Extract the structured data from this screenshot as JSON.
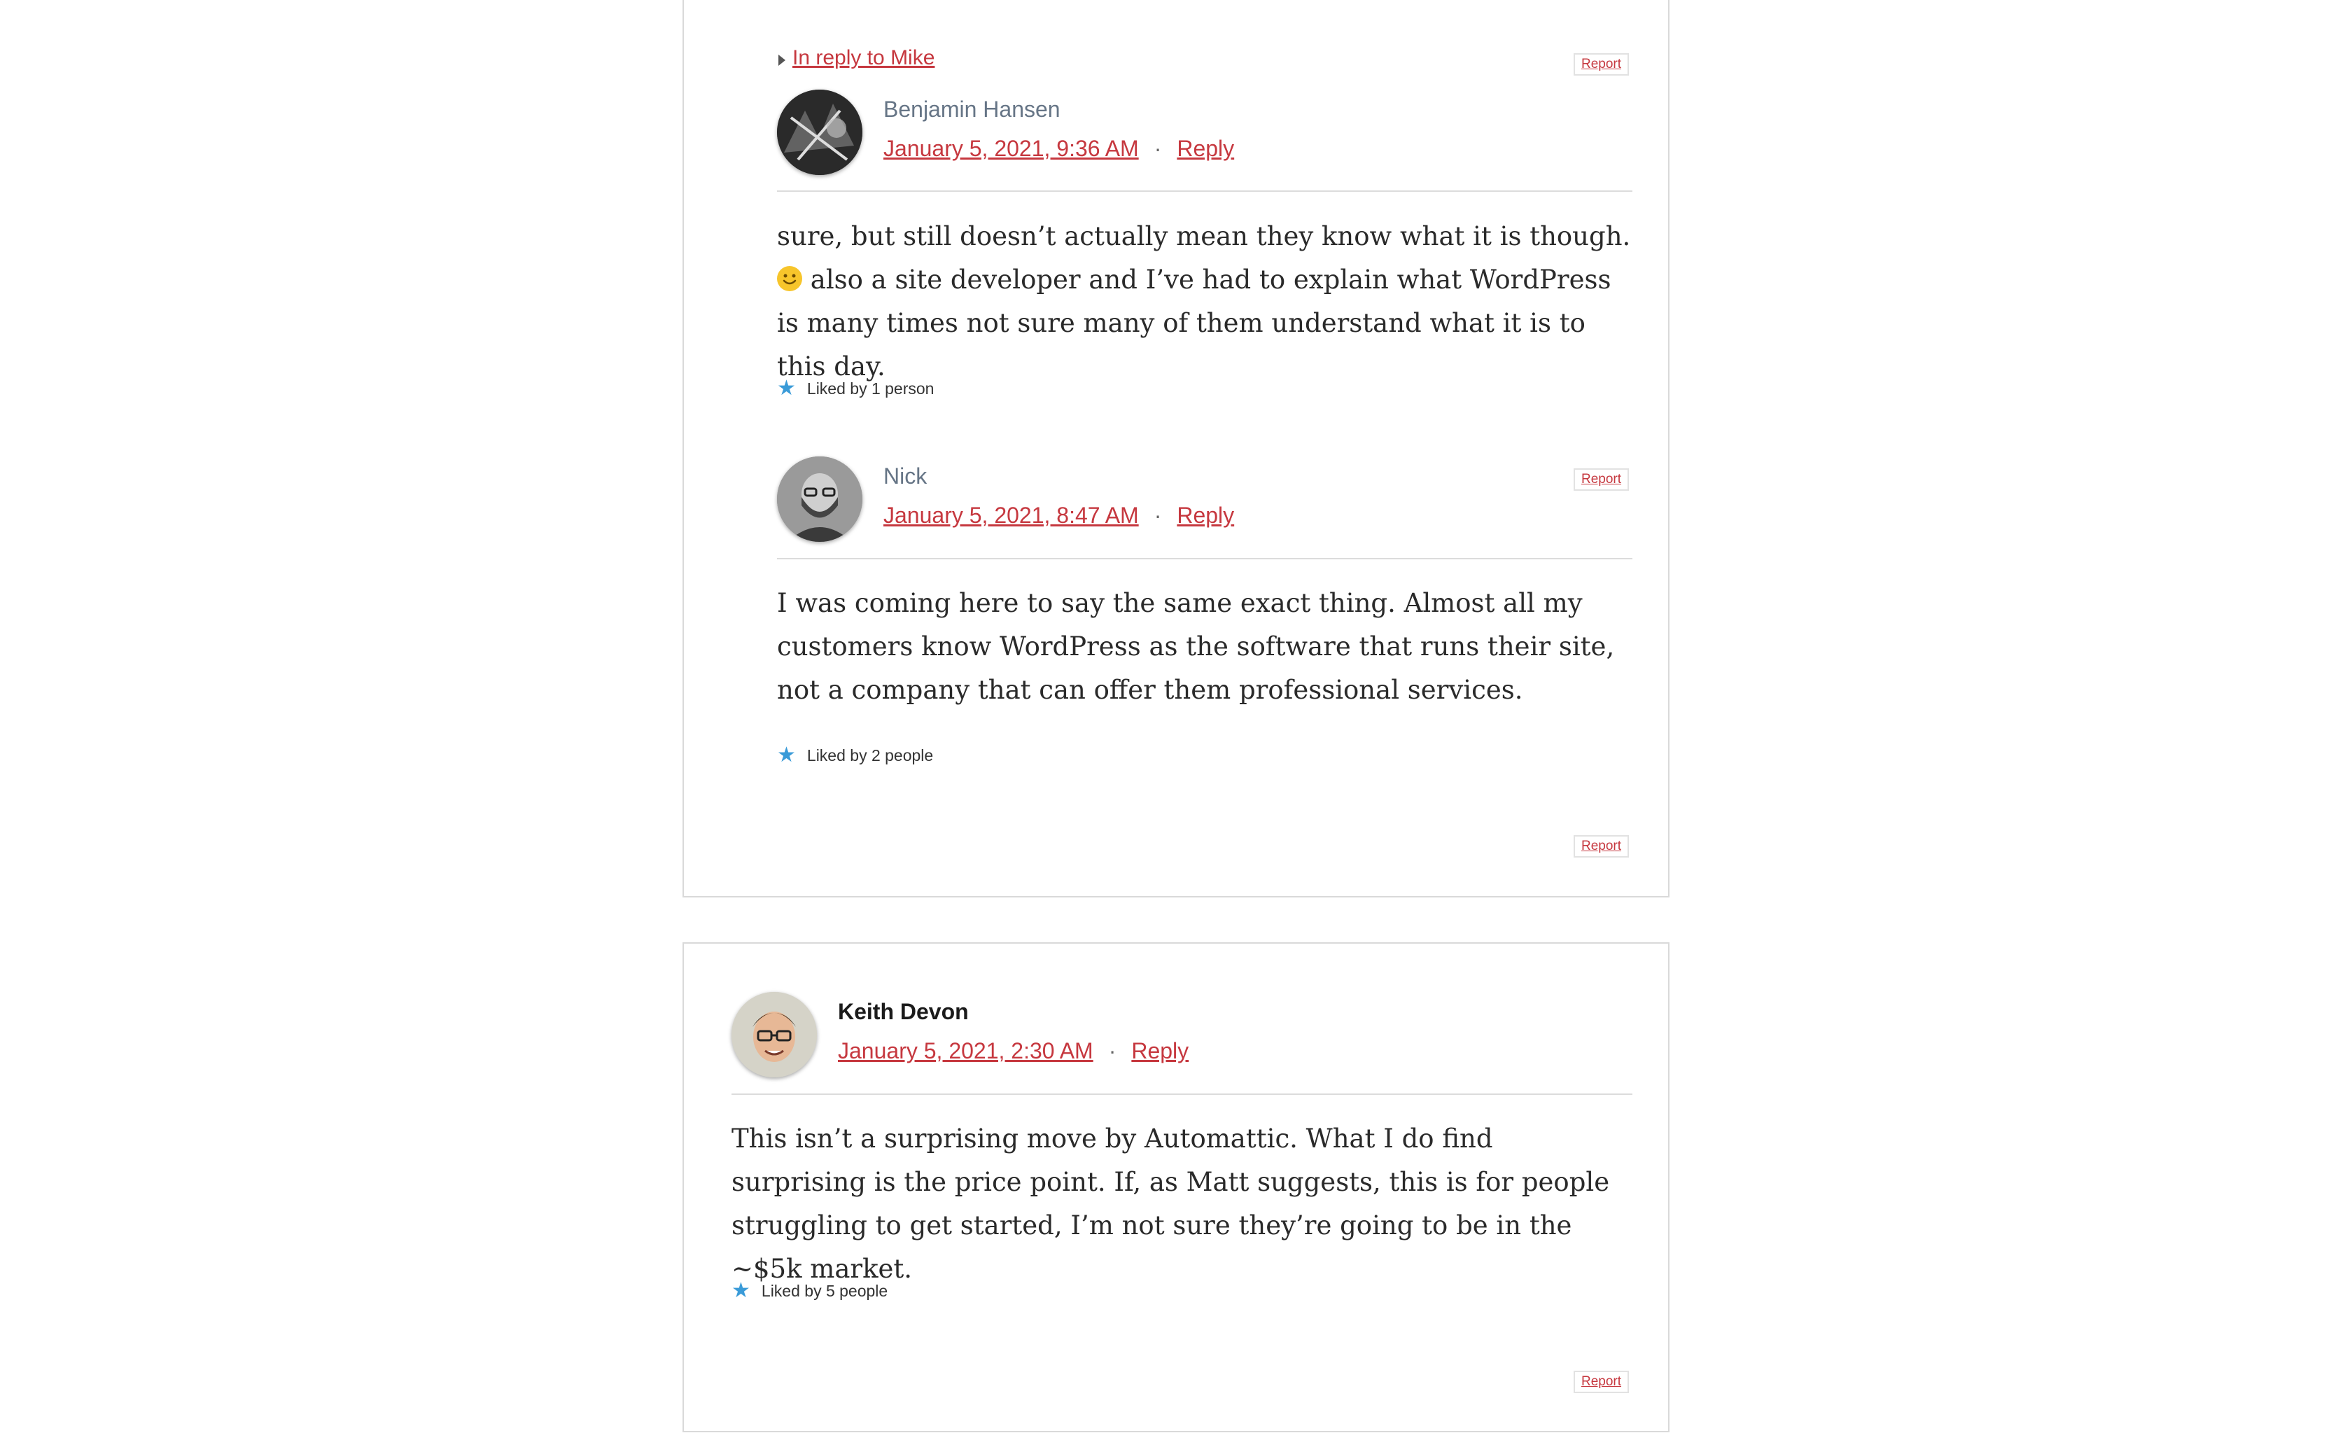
{
  "report_label": "Report",
  "card1": {
    "in_reply_to": "In reply to Mike",
    "comments": [
      {
        "author": "Benjamin Hansen",
        "date": "January 5, 2021, 9:36 AM",
        "reply": "Reply",
        "separator": "·",
        "text_before_emoji": "sure, but still doesn’t actually mean they know what it is though.",
        "emoji": "slightly-smiling-face-icon",
        "text_after_emoji": "also a site developer and I’ve had to explain what WordPress is many times not sure many of them understand what it is to this day.",
        "likes": "Liked by 1 person"
      },
      {
        "author": "Nick",
        "date": "January 5, 2021, 8:47 AM",
        "reply": "Reply",
        "separator": "·",
        "text": "I was coming here to say the same exact thing. Almost all my customers know WordPress as the software that runs their site, not a company that can offer them professional services.",
        "likes": "Liked by 2 people"
      }
    ]
  },
  "card2": {
    "comment": {
      "author": "Keith Devon",
      "date": "January 5, 2021, 2:30 AM",
      "reply": "Reply",
      "separator": "·",
      "text": "This isn’t a surprising move by Automattic. What I do find surprising is the price point. If, as Matt suggests, this is for people struggling to get started, I’m not sure they’re going to be in the ~$5k market.",
      "likes": "Liked by 5 people"
    }
  },
  "colors": {
    "link": "#c6383f",
    "author_muted": "#667586",
    "star": "#3a9bd8",
    "border": "#d9d9d9"
  }
}
